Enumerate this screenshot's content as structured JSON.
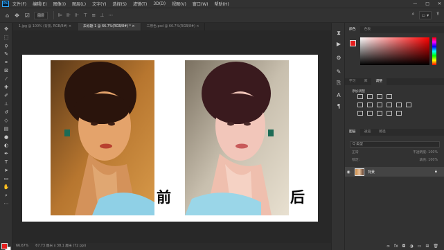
{
  "app": {
    "logo": "Ps"
  },
  "menu": [
    "文件(F)",
    "编辑(E)",
    "图像(I)",
    "图层(L)",
    "文字(Y)",
    "选择(S)",
    "滤镜(T)",
    "3D(D)",
    "视图(V)",
    "窗口(W)",
    "帮助(H)"
  ],
  "window_controls": {
    "minimize": "—",
    "restore": "□",
    "close": "✕"
  },
  "options_bar": {
    "mode_label": "图层"
  },
  "tabs": [
    {
      "label": "1.jpg @ 100% (背景, RGB/8#) ×"
    },
    {
      "label": "未标题-1 @ 66.7%(RGB/8#) * ×"
    },
    {
      "label": "三原色.psd @ 66.7%(RGB/8#) ×"
    }
  ],
  "canvas": {
    "label_before": "前",
    "label_after": "后"
  },
  "status": {
    "zoom": "66.67%",
    "doc_info": "67.73 厘米 x 38.1 厘米 (72 ppi)"
  },
  "right_panel": {
    "color_tabs": [
      "颜色",
      "色板"
    ],
    "adjust_tabs": [
      "学习",
      "库",
      "调整"
    ],
    "adjust_hint": "添加调整",
    "layer_tabs": [
      "图层",
      "通道",
      "路径"
    ],
    "kind_placeholder": "Q 类型",
    "blend_mode": "正常",
    "opacity_label": "不透明度: 100%",
    "lock_label": "锁定:",
    "fill_label": "填充: 100%",
    "layer_name": "背景"
  },
  "colors": {
    "foreground": "#e61e1e",
    "background": "#ffffff",
    "accent": "#31a8ff"
  }
}
